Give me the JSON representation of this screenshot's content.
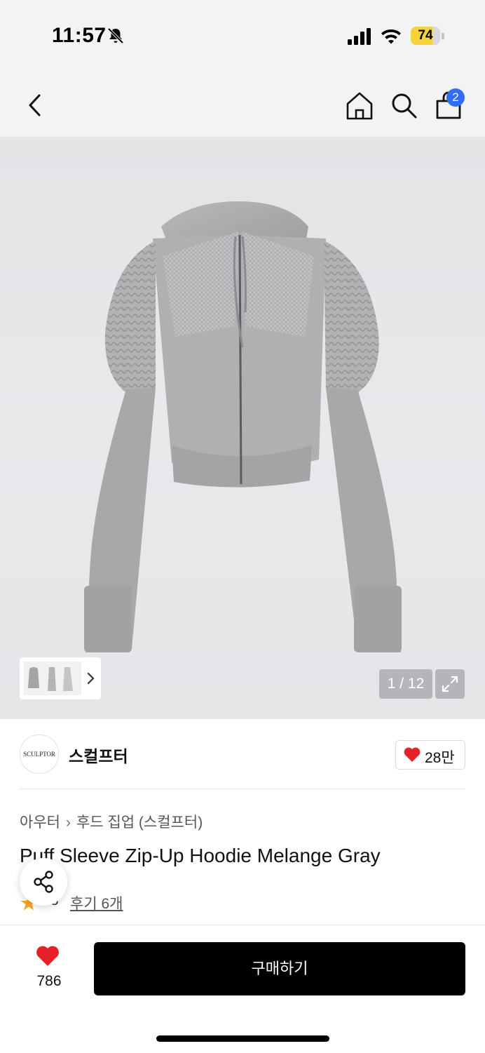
{
  "status_bar": {
    "time": "11:57",
    "battery_level": "74",
    "battery_fill_fraction": 0.74,
    "icons": [
      "bell-slash-icon",
      "signal-icon",
      "wifi-icon",
      "battery-icon"
    ]
  },
  "nav": {
    "back_icon": "chevron-left-icon",
    "home_icon": "home-icon",
    "search_icon": "search-icon",
    "cart_icon": "shopping-bag-icon",
    "cart_count": "2"
  },
  "gallery": {
    "counter": "1 / 12",
    "expand_icon": "expand-icon",
    "thumbnail_chevron": "chevron-right-icon"
  },
  "brand": {
    "logo_text": "SCULPTOR",
    "name": "스컬프터",
    "likes": "28만"
  },
  "product": {
    "breadcrumb": [
      "아우터",
      "후드 집업 (스컬프터)"
    ],
    "title": "Puff Sleeve Zip-Up Hoodie Melange Gray",
    "rating": ".8",
    "reviews": "후기 6개"
  },
  "bottom": {
    "wish_count": "786",
    "buy_label": "구매하기"
  },
  "colors": {
    "accent_blue": "#2f6ef5",
    "heart_red": "#e8202a",
    "battery_yellow": "#f5d33a",
    "star_orange": "#f5a623"
  }
}
